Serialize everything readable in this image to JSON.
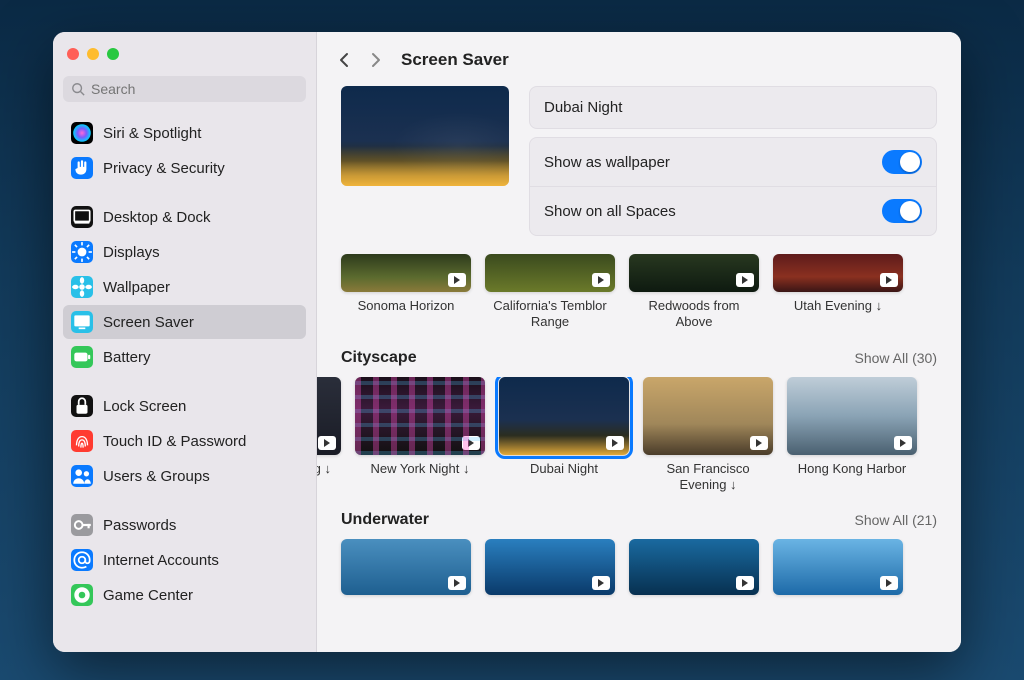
{
  "search": {
    "placeholder": "Search"
  },
  "sidebar": {
    "items": [
      {
        "label": "Siri & Spotlight",
        "icon": "siri",
        "color": "#000"
      },
      {
        "label": "Privacy & Security",
        "icon": "hand",
        "color": "#0a7aff"
      },
      {
        "gap": true
      },
      {
        "label": "Desktop & Dock",
        "icon": "dock",
        "color": "#111"
      },
      {
        "label": "Displays",
        "icon": "sun",
        "color": "#0a7aff"
      },
      {
        "label": "Wallpaper",
        "icon": "flower",
        "color": "#29c0e8"
      },
      {
        "label": "Screen Saver",
        "icon": "screen",
        "color": "#29c0e8",
        "selected": true
      },
      {
        "label": "Battery",
        "icon": "battery",
        "color": "#34c759"
      },
      {
        "gap": true
      },
      {
        "label": "Lock Screen",
        "icon": "lock",
        "color": "#111"
      },
      {
        "label": "Touch ID & Password",
        "icon": "finger",
        "color": "#ff3b30"
      },
      {
        "label": "Users & Groups",
        "icon": "users",
        "color": "#0a7aff"
      },
      {
        "gap": true
      },
      {
        "label": "Passwords",
        "icon": "key",
        "color": "#9a9a9e"
      },
      {
        "label": "Internet Accounts",
        "icon": "at",
        "color": "#0a7aff"
      },
      {
        "label": "Game Center",
        "icon": "game",
        "color": "#34c759"
      }
    ]
  },
  "header": {
    "title": "Screen Saver"
  },
  "current": {
    "name": "Dubai Night",
    "options": [
      {
        "label": "Show as wallpaper",
        "on": true
      },
      {
        "label": "Show on all Spaces",
        "on": true
      }
    ]
  },
  "sections": [
    {
      "title": "",
      "partialTop": true,
      "items": [
        {
          "label": "Sonoma Horizon",
          "palette": "t-sonoma"
        },
        {
          "label": "California's Temblor Range",
          "palette": "t-calif"
        },
        {
          "label": "Redwoods from Above",
          "palette": "t-redw"
        },
        {
          "label": "Utah Evening ↓",
          "palette": "t-utah"
        }
      ]
    },
    {
      "title": "Cityscape",
      "showAll": "Show All (30)",
      "stripClass": "cityscape",
      "items": [
        {
          "label": "ening ↓",
          "palette": "t-evening",
          "clip": true
        },
        {
          "label": "New York Night ↓",
          "palette": "t-nyn"
        },
        {
          "label": "Dubai Night",
          "palette": "t-dubai",
          "selected": true
        },
        {
          "label": "San Francisco Evening ↓",
          "palette": "t-sf"
        },
        {
          "label": "Hong Kong Harbor",
          "palette": "t-hk"
        }
      ]
    },
    {
      "title": "Underwater",
      "showAll": "Show All (21)",
      "stripClass": "underwater",
      "items": [
        {
          "label": "",
          "palette": "t-uw1"
        },
        {
          "label": "",
          "palette": "t-uw2"
        },
        {
          "label": "",
          "palette": "t-uw3"
        },
        {
          "label": "",
          "palette": "t-uw4"
        }
      ]
    }
  ]
}
